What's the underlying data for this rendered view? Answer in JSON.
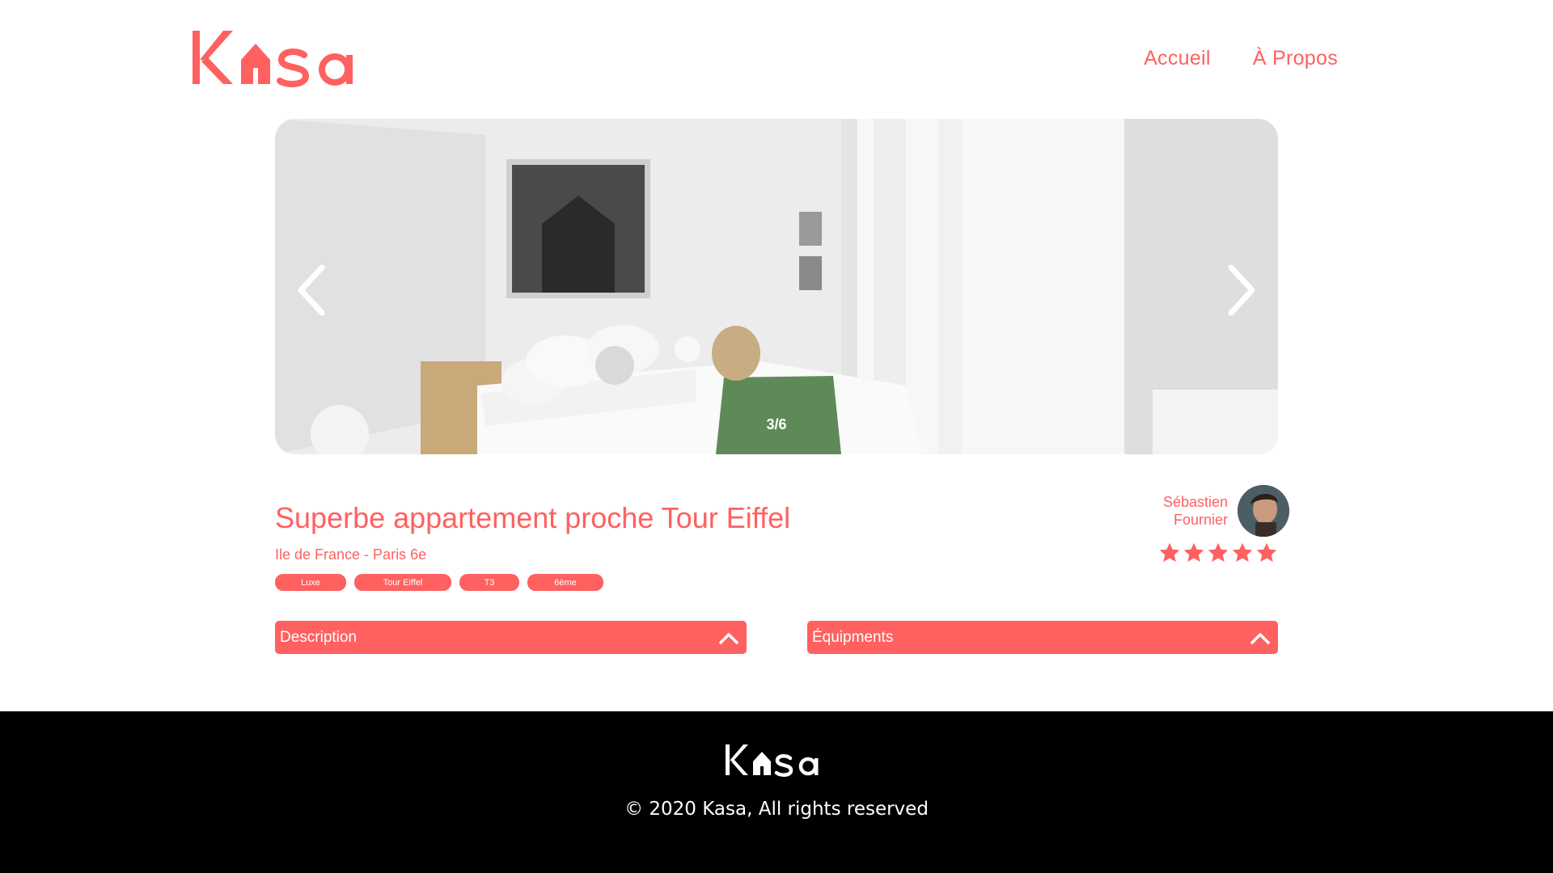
{
  "brand": {
    "name": "Kasa",
    "accent_color": "#ff6060"
  },
  "nav": {
    "home_label": "Accueil",
    "about_label": "À Propos"
  },
  "gallery": {
    "counter": "3/6",
    "current": 3,
    "total": 6,
    "prev_icon": "chevron-left-icon",
    "next_icon": "chevron-right-icon"
  },
  "listing": {
    "title": "Superbe appartement proche Tour Eiffel",
    "location": "Ile de France - Paris 6e",
    "tags": [
      "Luxe",
      "Tour Eiffel",
      "T3",
      "6ème"
    ]
  },
  "host": {
    "first_name": "Sébastien",
    "last_name": "Fournier",
    "rating": 5,
    "rating_max": 5
  },
  "collapses": {
    "description_label": "Description",
    "equipments_label": "Équipments"
  },
  "footer": {
    "copyright": "© 2020 Kasa, All rights reserved",
    "background": "#000000"
  }
}
